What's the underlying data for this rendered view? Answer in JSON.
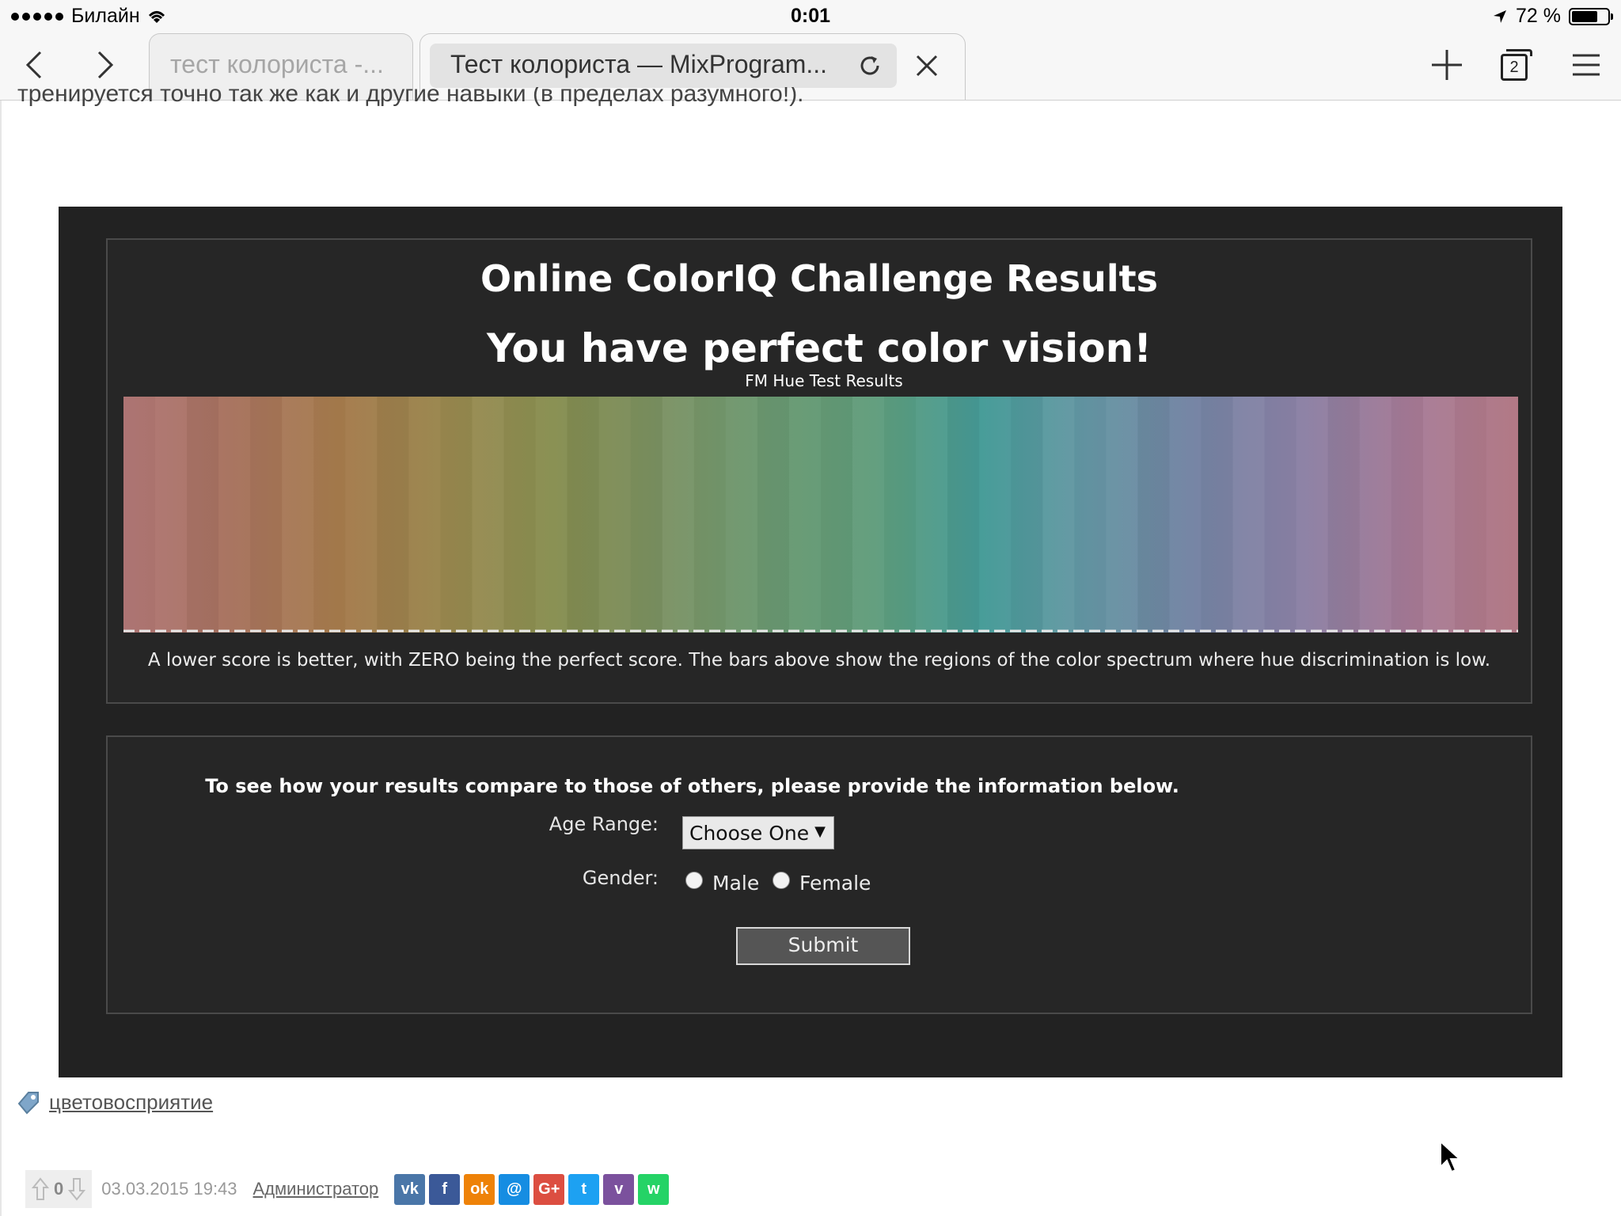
{
  "status_bar": {
    "carrier": "Билайн",
    "time": "0:01",
    "battery": "72 %",
    "battery_level": 0.72
  },
  "browser": {
    "tabs": [
      {
        "title": "тест колориста -...",
        "active": false
      },
      {
        "title": "Тест колориста — MixProgram...",
        "active": true
      }
    ],
    "tab_count": "2",
    "icons": [
      "back-icon",
      "forward-icon",
      "reload-icon",
      "close-icon",
      "new-tab-icon",
      "tabs-icon",
      "menu-icon"
    ]
  },
  "page": {
    "cut_text": "тренируется точно так же как и другие навыки (в пределах разумного!).",
    "widget": {
      "title": "Online ColorIQ Challenge Results",
      "subtitle": "You have perfect color vision!",
      "chart_title": "FM Hue Test Results",
      "note": "A lower score is better, with ZERO being the perfect score. The bars above show the regions of the color spectrum where hue discrimination is low.",
      "form": {
        "prompt": "To see how your results compare to those of others, please provide the information below.",
        "age_label": "Age Range:",
        "age_value": "Choose One",
        "gender_label": "Gender:",
        "male_label": "Male",
        "female_label": "Female",
        "submit_label": "Submit"
      }
    },
    "tag": "цветовосприятие",
    "meta": {
      "votes": "0",
      "date": "03.03.2015 19:43",
      "author": "Администратор"
    },
    "share_buttons": [
      {
        "name": "vk",
        "glyph": "vk",
        "color": "#4a76a8"
      },
      {
        "name": "facebook",
        "glyph": "f",
        "color": "#3b5998"
      },
      {
        "name": "odnoklassniki",
        "glyph": "ok",
        "color": "#ee8208"
      },
      {
        "name": "moimir",
        "glyph": "@",
        "color": "#168de2"
      },
      {
        "name": "google-plus",
        "glyph": "G+",
        "color": "#dc4e41"
      },
      {
        "name": "twitter",
        "glyph": "t",
        "color": "#1da1f2"
      },
      {
        "name": "viber",
        "glyph": "v",
        "color": "#7b519d"
      },
      {
        "name": "whatsapp",
        "glyph": "w",
        "color": "#25d366"
      }
    ]
  },
  "chart_data": {
    "type": "heatmap",
    "title": "FM Hue Test Results",
    "description_of_values": "hue spectrum strip; no discrimination-error bars shown (perfect score)",
    "score": 0,
    "spectrum_stops": [
      "#b07676",
      "#a8735f",
      "#a57a4c",
      "#9a884f",
      "#878e50",
      "#7a9061",
      "#6c9a72",
      "#5e9c7a",
      "#469c98",
      "#6495a3",
      "#7584a4",
      "#8b80a4",
      "#a67a96",
      "#b07682"
    ]
  }
}
